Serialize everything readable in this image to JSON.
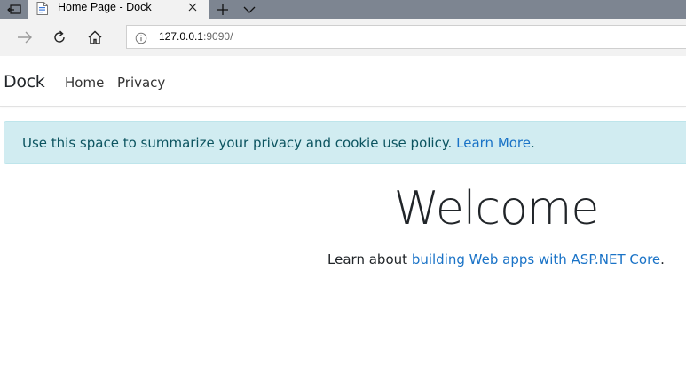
{
  "browser": {
    "tab_title": "Home Page - Dock",
    "url_host": "127.0.0.1",
    "url_rest": ":9090/"
  },
  "site": {
    "brand": "Dock",
    "nav": [
      {
        "label": "Home"
      },
      {
        "label": "Privacy"
      }
    ]
  },
  "cookie_alert": {
    "text": "Use this space to summarize your privacy and cookie use policy.",
    "link_text": "Learn More",
    "suffix": "."
  },
  "main": {
    "heading": "Welcome",
    "learn_prefix": "Learn about",
    "learn_link": "building Web apps with ASP.NET Core",
    "learn_suffix": "."
  },
  "colors": {
    "tabstrip": "#7d8591",
    "alert_bg": "#d1ecf1",
    "link": "#1a73c7"
  }
}
